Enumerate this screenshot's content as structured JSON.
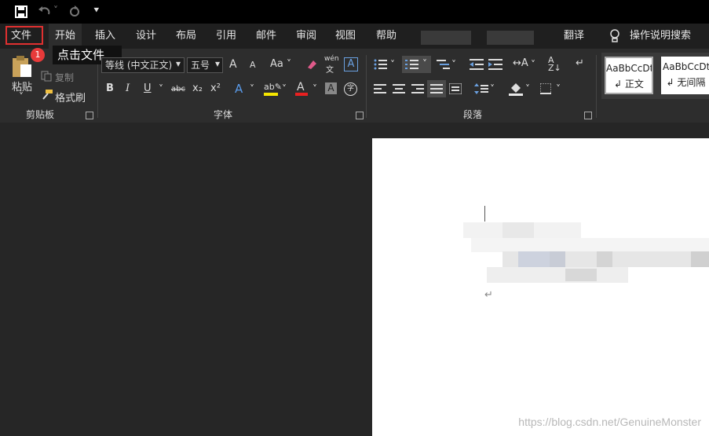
{
  "titlebar": {
    "save_icon": "save-icon",
    "undo_icon": "undo-icon",
    "redo_icon": "redo-icon",
    "customize_icon": "customize-icon"
  },
  "menu": {
    "file": "文件",
    "tabs": [
      "开始",
      "插入",
      "设计",
      "布局",
      "引用",
      "邮件",
      "审阅",
      "视图",
      "帮助"
    ],
    "translate": "翻译",
    "tell_me": "操作说明搜索"
  },
  "annotation": {
    "badge": "1",
    "tooltip": "点击文件"
  },
  "clipboard": {
    "paste": "粘贴",
    "copy": "复制",
    "format_painter": "格式刷",
    "group": "剪贴板"
  },
  "font": {
    "name": "等线 (中文正文)",
    "size": "五号",
    "grow": "A",
    "shrink": "A",
    "case": "Aa",
    "wen": "wén",
    "bold": "B",
    "italic": "I",
    "underline": "U",
    "strike": "abc",
    "sub": "x₂",
    "sup": "x²",
    "text_effect": "A",
    "font_color": "A",
    "char_shade": "A",
    "group": "字体",
    "colors": {
      "highlight": "#f5e600",
      "font_color": "#e82020"
    }
  },
  "paragraph": {
    "group": "段落"
  },
  "styles": [
    {
      "sample": "AaBbCcDt",
      "name": "正文"
    },
    {
      "sample": "AaBbCcDt",
      "name": "无间隔"
    }
  ],
  "document": {
    "return_mark": "↵"
  },
  "watermark": "https://blog.csdn.net/GenuineMonster"
}
